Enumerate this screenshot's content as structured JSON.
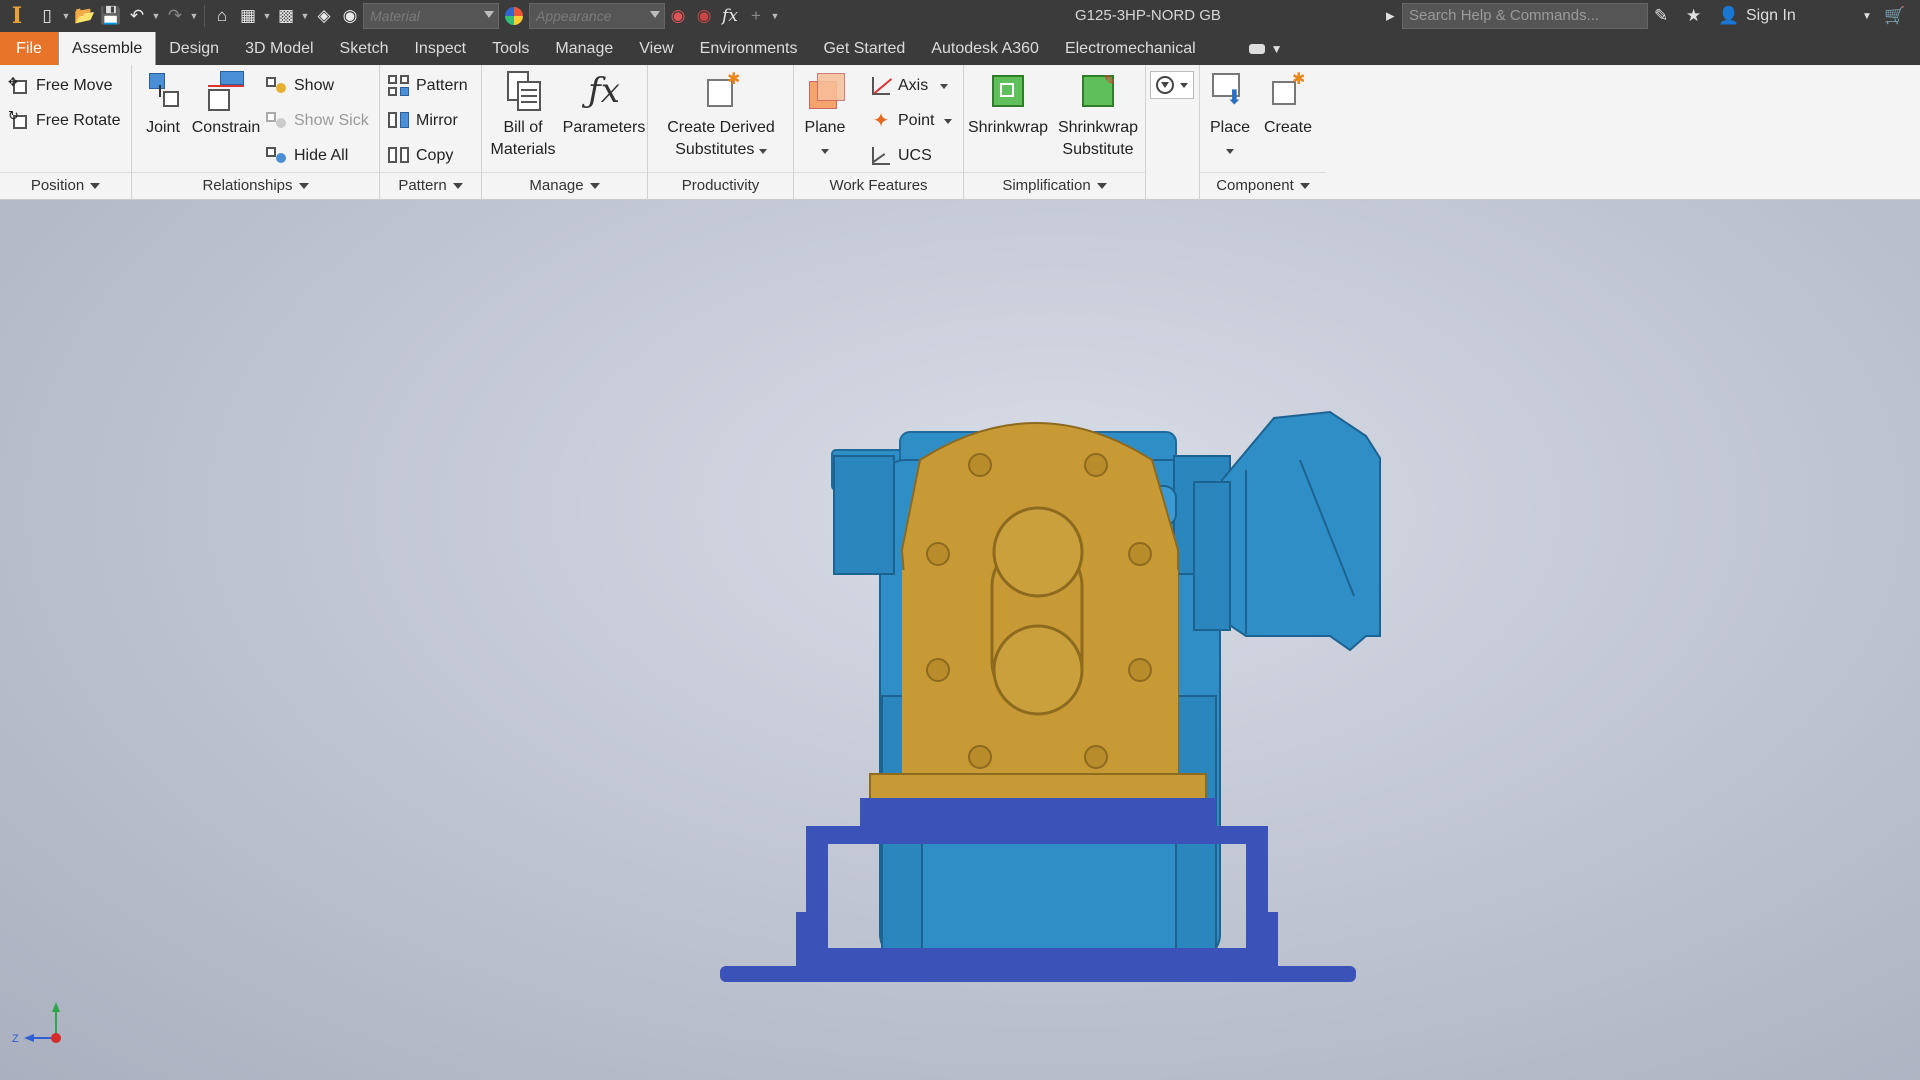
{
  "app": {
    "logo": "I",
    "document_title": "G125-3HP-NORD GB",
    "material_placeholder": "Material",
    "appearance_placeholder": "Appearance",
    "search_placeholder": "Search Help & Commands...",
    "sign_in": "Sign In",
    "fx_label": "fx"
  },
  "tabs": [
    {
      "label": "File"
    },
    {
      "label": "Assemble"
    },
    {
      "label": "Design"
    },
    {
      "label": "3D Model"
    },
    {
      "label": "Sketch"
    },
    {
      "label": "Inspect"
    },
    {
      "label": "Tools"
    },
    {
      "label": "Manage"
    },
    {
      "label": "View"
    },
    {
      "label": "Environments"
    },
    {
      "label": "Get Started"
    },
    {
      "label": "Autodesk A360"
    },
    {
      "label": "Electromechanical"
    }
  ],
  "ribbon": {
    "position": {
      "title": "Position",
      "free_move": "Free Move",
      "free_rotate": "Free Rotate"
    },
    "relationships": {
      "title": "Relationships",
      "joint": "Joint",
      "constrain": "Constrain",
      "show": "Show",
      "show_sick": "Show Sick",
      "hide_all": "Hide All"
    },
    "pattern": {
      "title": "Pattern",
      "pattern": "Pattern",
      "mirror": "Mirror",
      "copy": "Copy"
    },
    "manage": {
      "title": "Manage",
      "bom_line1": "Bill of",
      "bom_line2": "Materials",
      "parameters": "Parameters"
    },
    "productivity": {
      "title": "Productivity",
      "line1": "Create Derived",
      "line2": "Substitutes"
    },
    "work_features": {
      "title": "Work Features",
      "plane": "Plane",
      "axis": "Axis",
      "point": "Point",
      "ucs": "UCS"
    },
    "simplification": {
      "title": "Simplification",
      "shrinkwrap": "Shrinkwrap",
      "sws_line1": "Shrinkwrap",
      "sws_line2": "Substitute"
    },
    "component": {
      "title": "Component",
      "place": "Place",
      "create": "Create"
    }
  },
  "colors": {
    "motor_blue": "#2f8ec6",
    "gearbox_gold": "#c89a35",
    "base_blue": "#3b53b8",
    "file_tab": "#e8742a"
  },
  "triad": {
    "z_label": "Z"
  }
}
